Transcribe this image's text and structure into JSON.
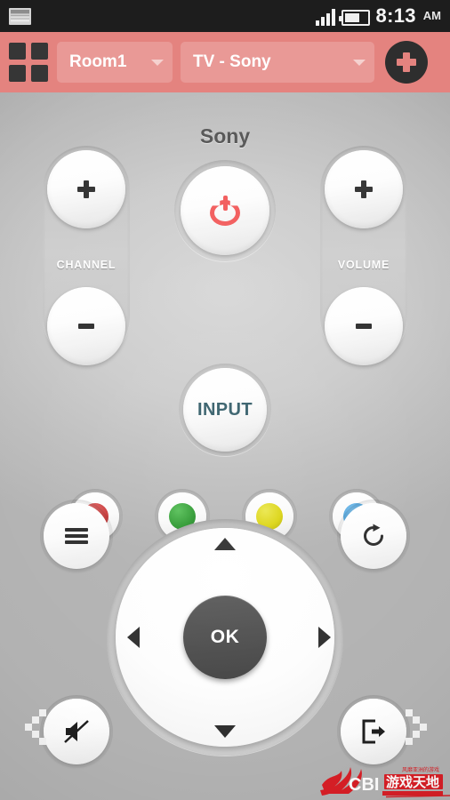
{
  "statusbar": {
    "notification_icon": "screenshot-icon",
    "signal_icon": "signal-bars-icon",
    "battery_icon": "battery-icon",
    "time": "8:13",
    "meridiem": "AM"
  },
  "header": {
    "grid_icon": "grid-menu-icon",
    "room": {
      "label": "Room1",
      "caret_icon": "chevron-down-icon"
    },
    "device": {
      "label": "TV - Sony",
      "caret_icon": "chevron-down-icon"
    },
    "add_button": {
      "icon": "plus-icon",
      "bg": "#2e2e2e",
      "glyph_color": "#e4837f"
    },
    "bg": "#e4837f"
  },
  "remote": {
    "brand": "Sony",
    "channel": {
      "label": "CHANNEL",
      "up": {
        "glyph": "plus-icon"
      },
      "down": {
        "glyph": "minus-icon"
      }
    },
    "volume": {
      "label": "VOLUME",
      "up": {
        "glyph": "plus-icon"
      },
      "down": {
        "glyph": "minus-icon"
      }
    },
    "power": {
      "icon": "power-icon",
      "color": "#f25a5a"
    },
    "input": {
      "label": "INPUT",
      "color": "#2c5763"
    },
    "color_keys": [
      {
        "name": "red-color-button",
        "color": "#cc3b3b"
      },
      {
        "name": "green-color-button",
        "color": "#2d9930"
      },
      {
        "name": "yellow-color-button",
        "color": "#dbd411"
      },
      {
        "name": "blue-color-button",
        "color": "#45a0dd"
      }
    ],
    "menu_button": {
      "icon": "hamburger-menu-icon"
    },
    "refresh_button": {
      "icon": "refresh-icon"
    },
    "mute_button": {
      "icon": "mute-icon"
    },
    "exit_button": {
      "icon": "exit-icon"
    },
    "dpad": {
      "up": "up-arrow-icon",
      "down": "down-arrow-icon",
      "left": "left-arrow-icon",
      "right": "right-arrow-icon",
      "ok_label": "OK"
    },
    "page_prev_icon": "chevron-left-icon",
    "page_next_icon": "chevron-right-icon",
    "watermark": "CBI 游戏天地"
  }
}
